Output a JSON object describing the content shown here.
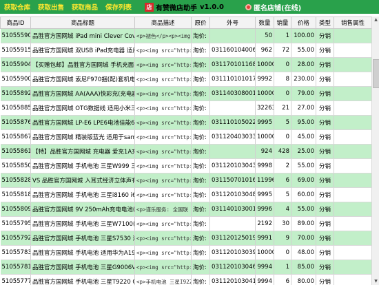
{
  "toolbar": {
    "buttons": [
      "获取仓库",
      "获取出售",
      "获取商品",
      "保存列表"
    ],
    "logo": "店",
    "app_title": "有赞微店助手",
    "app_version": "v1.0.0",
    "shop_status": "匿名店铺(在线)"
  },
  "table": {
    "headers": [
      "商品ID",
      "商品标题",
      "商品描述",
      "原价",
      "外号",
      "数量",
      "销量",
      "价格",
      "类型",
      "销售属性"
    ],
    "rows": [
      [
        "51055590",
        "品胜官方国网城 iPad mini Clever Cover提件系列",
        "<p>褪色</p><p><img src",
        "淘价:",
        "",
        "50",
        "1",
        "100.00",
        "分销",
        ""
      ],
      [
        "51055915",
        "品胜官方国网城 双USB iPad充电器 适用于iPad 三",
        "<p><img src=\"http://in",
        "淘价:",
        "031160104006",
        "962",
        "72",
        "55.00",
        "分销",
        ""
      ],
      [
        "51055904",
        "【买赠包邮】品胜官方国网城 手机充面8膜 华为",
        "<p><img src=\"http://in",
        "淘价:",
        "031170101168",
        "10000",
        "0",
        "28.00",
        "分销",
        ""
      ],
      [
        "51055900",
        "品胜官方国网城 索尼F970捆(配)套机电池(SC55 FD8",
        "<p><img src=\"http://in",
        "淘价:",
        "031110101017",
        "9992",
        "8",
        "230.00",
        "分销",
        ""
      ],
      [
        "51055892",
        "品胜官方国网城 AA(AAA)快彩充(充电器电池电源组",
        "<p><img src=\"http://in",
        "淘价:",
        "031140308001",
        "10000",
        "0",
        "79.00",
        "分销",
        ""
      ],
      [
        "51055885",
        "品胜官方国网城 OTG数据线 适用小米三星华为手机",
        "<p><img src=\"http://in",
        "淘价:",
        "",
        "32263",
        "21",
        "27.00",
        "分销",
        ""
      ],
      [
        "51055876",
        "品胜官方国网城 LP-E6 LPE6电池佳能600D 7000D电池",
        "<p><img src=\"http://in",
        "淘价:",
        "031110105022",
        "9995",
        "5",
        "95.00",
        "分销",
        ""
      ],
      [
        "51055867",
        "品胜官方国网城 精装版蓝光 适用于samsung三星S9",
        "<p><img src=\"http://in",
        "淘价:",
        "031120403033",
        "10000",
        "0",
        "45.00",
        "分销",
        ""
      ],
      [
        "51055861",
        "【特】品胜官方国网城 充电器 爱充1A充电头 适用",
        "<p><img src=\"http://in",
        "淘价:",
        "",
        "924",
        "428",
        "25.00",
        "分销",
        ""
      ],
      [
        "51055850",
        "品胜官方国网城 手机电池 三星W999 三星S7530电池",
        "<p><img src=\"http://in",
        "淘价:",
        "031120103043",
        "9998",
        "2",
        "55.00",
        "分销",
        ""
      ],
      [
        "51055828",
        "VS 品胜官方国网城 入耳式经济立体声有线耳机 HM",
        "<p><img src=\"http://in",
        "淘价:",
        "031150701016",
        "11996",
        "6",
        "69.00",
        "分销",
        ""
      ],
      [
        "51055818",
        "品胜官方国网城 手机电池 三星i8160 i699 iT39 iT",
        "<p><img src=\"http://in",
        "淘价:",
        "031120103048",
        "9995",
        "5",
        "60.00",
        "分销",
        ""
      ],
      [
        "51055809",
        "品胜官方国网城 9V 250mAh充电电池(每卡1粒) [麦",
        "<p>谨乐服务: 全国联",
        "淘价:",
        "031140103001",
        "9996",
        "4",
        "55.00",
        "分销",
        ""
      ],
      [
        "51055795",
        "品胜官方国网城 手机电池 三星W7100(Note2 E250S/",
        "<p><img src=\"http://in",
        "淘价:",
        "",
        "2192",
        "30",
        "89.00",
        "分销",
        ""
      ],
      [
        "51055792",
        "品胜官方国网城 手机电池 三星S7530 适用于Ascen",
        "<p><img src=\"http://in",
        "淘价:",
        "031120125019",
        "9991",
        "9",
        "70.00",
        "分销",
        ""
      ],
      [
        "51055783",
        "品胜官方国网城 手机电池 适用华为A199(华为Ascen",
        "<p><img src=\"http://in",
        "淘价:",
        "031120103039",
        "10000",
        "0",
        "48.00",
        "分销",
        ""
      ],
      [
        "51055781",
        "品胜官方国网城 手机电池 三星G9006V(G9006V)电",
        "<p><img src=\"http://in",
        "淘价:",
        "031120103046",
        "9994",
        "1",
        "85.00",
        "分销",
        ""
      ],
      [
        "51055777",
        "品胜官方国网城 手机电池 三星T9220 Galaxy Note",
        "<p>手机电池 三星I922",
        "淘价:",
        "031120103041",
        "9994",
        "6",
        "80.00",
        "分销",
        ""
      ]
    ],
    "row_183_note": ""
  },
  "colors": {
    "toolbar_bg": "#29a14b",
    "toolbar_button_text": "#ffe830",
    "row_alt_bg": "#c2efc9",
    "row_selected_bg": "#2f7fde"
  }
}
